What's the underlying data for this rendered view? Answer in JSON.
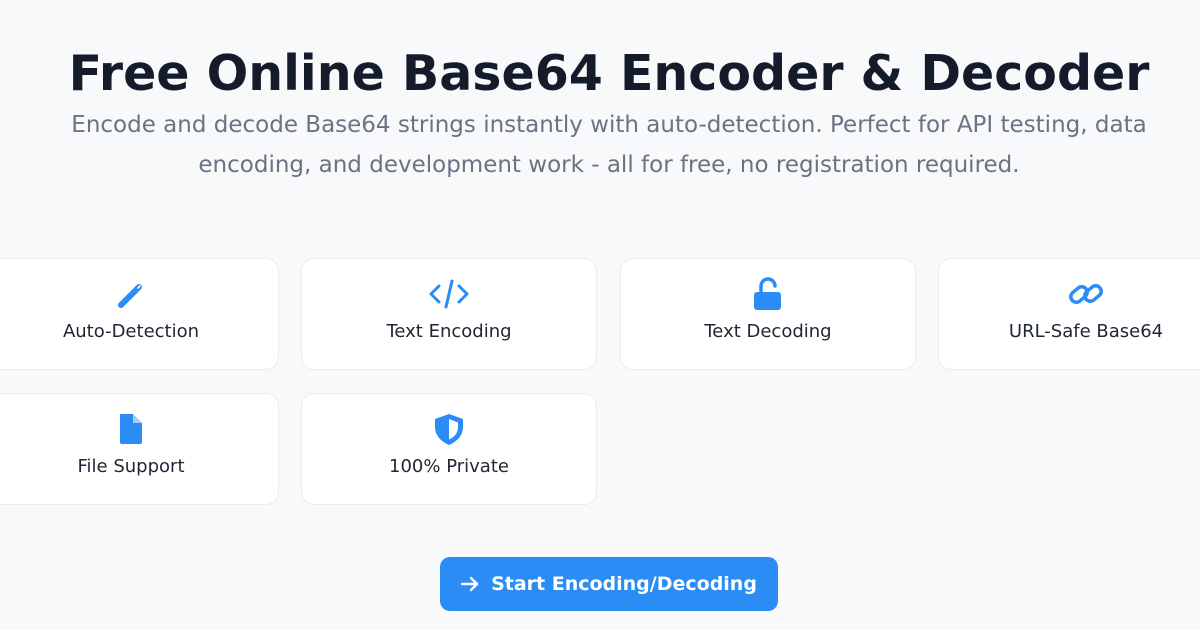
{
  "hero": {
    "title": "Free Online Base64 Encoder & Decoder",
    "subtitle_line1": "Encode and decode Base64 strings instantly with auto-detection. Perfect for API testing, data",
    "subtitle_line2": "encoding, and development work - all for free, no registration required."
  },
  "features": [
    {
      "label": "Auto-Detection",
      "icon": "magic-wand-icon"
    },
    {
      "label": "Text Encoding",
      "icon": "code-icon"
    },
    {
      "label": "Text Decoding",
      "icon": "unlock-icon"
    },
    {
      "label": "URL-Safe Base64",
      "icon": "link-icon"
    },
    {
      "label": "File Support",
      "icon": "file-icon"
    },
    {
      "label": "100% Private",
      "icon": "shield-icon"
    }
  ],
  "cta": {
    "label": "Start Encoding/Decoding",
    "icon": "arrow-right-icon"
  },
  "colors": {
    "accent": "#2b8cf5",
    "background": "#f8f9fb",
    "title": "#141c2c",
    "subtitle": "#6b7382"
  }
}
